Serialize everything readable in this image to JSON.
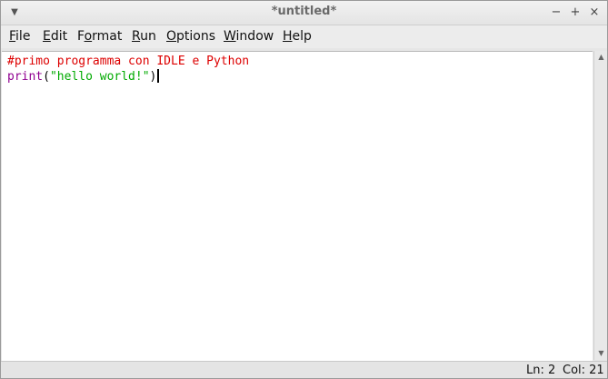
{
  "window": {
    "title": "*untitled*",
    "menu_arrow_glyph": "▼",
    "minimize_glyph": "−",
    "maximize_glyph": "+",
    "close_glyph": "×"
  },
  "menubar": {
    "items": [
      {
        "underline": "F",
        "rest": "ile"
      },
      {
        "underline": "E",
        "rest": "dit"
      },
      {
        "prefix": "F",
        "underline": "o",
        "rest": "rmat"
      },
      {
        "underline": "R",
        "rest": "un"
      },
      {
        "underline": "O",
        "rest": "ptions"
      },
      {
        "underline": "W",
        "rest": "indow"
      },
      {
        "underline": "H",
        "rest": "elp"
      }
    ]
  },
  "editor": {
    "line1_comment": "#primo programma con IDLE e Python",
    "line2_builtin": "print",
    "line2_open": "(",
    "line2_string": "\"hello world!\"",
    "line2_close": ")"
  },
  "scrollbar": {
    "up_glyph": "▲",
    "down_glyph": "▼"
  },
  "status": {
    "line": "Ln: 2",
    "col": "Col: 21"
  },
  "colors": {
    "comment": "#dd0000",
    "builtin": "#900090",
    "string": "#00aa00"
  }
}
